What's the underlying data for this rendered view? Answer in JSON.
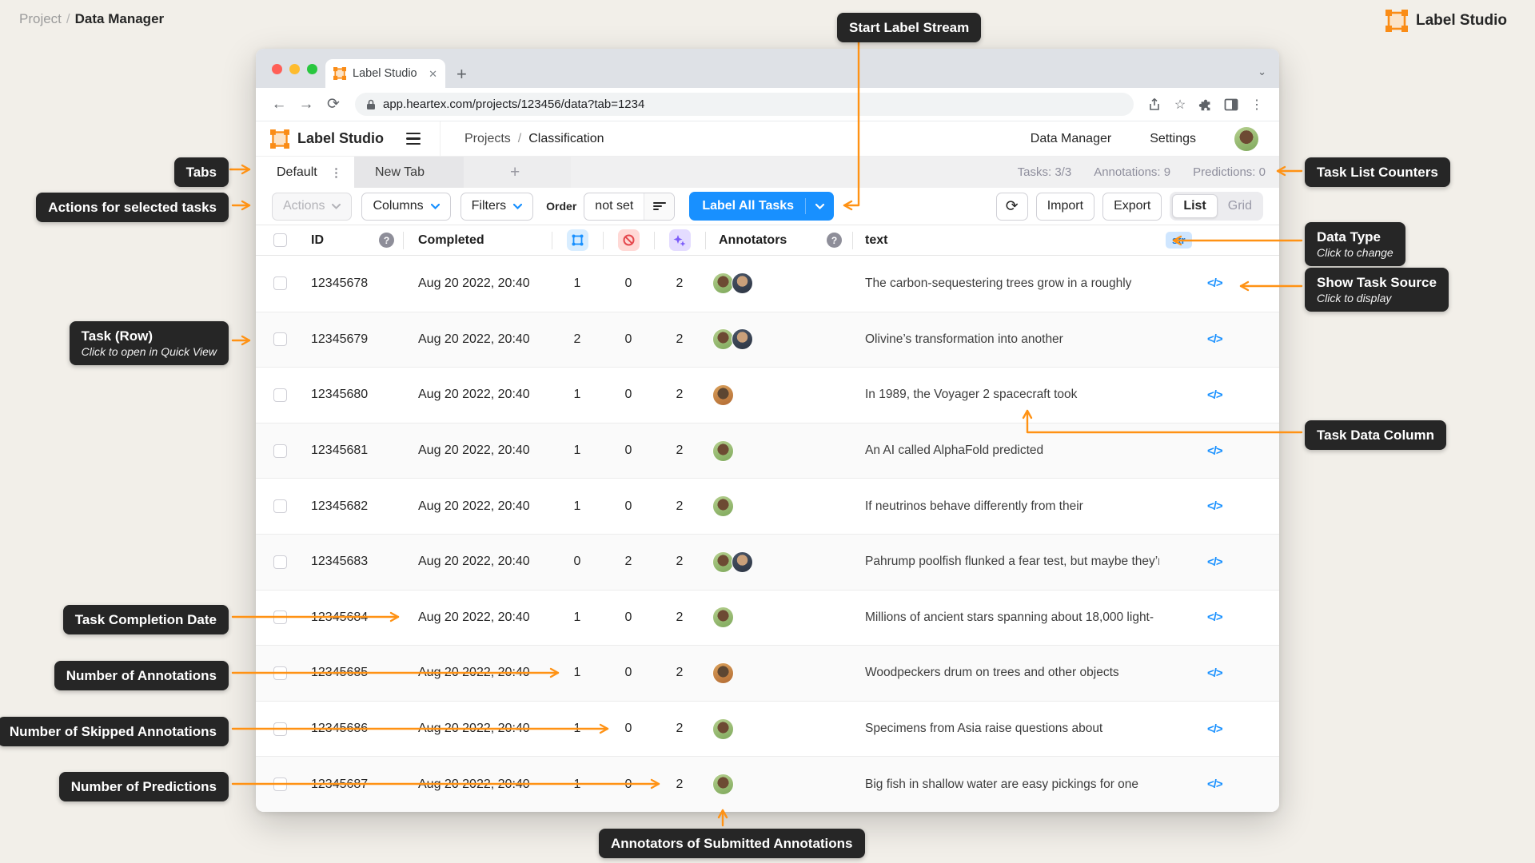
{
  "page": {
    "breadcrumb": {
      "parent": "Project",
      "divider": "/",
      "current": "Data Manager"
    },
    "brand": "Label Studio"
  },
  "browser": {
    "tab_title": "Label Studio",
    "url": "app.heartex.com/projects/123456/data?tab=1234"
  },
  "header": {
    "brand": "Label Studio",
    "breadcrumb_root": "Projects",
    "breadcrumb_divider": "/",
    "breadcrumb_current": "Classification",
    "nav_data_manager": "Data Manager",
    "nav_settings": "Settings"
  },
  "view_tabs": {
    "active_tab": "Default",
    "second_tab": "New Tab",
    "counters": [
      {
        "label": "Tasks:",
        "value": "3/3"
      },
      {
        "label": "Annotations:",
        "value": "9"
      },
      {
        "label": "Predictions:",
        "value": "0"
      }
    ]
  },
  "toolbar": {
    "actions": "Actions",
    "columns": "Columns",
    "filters": "Filters",
    "order_label": "Order",
    "order_value": "not set",
    "label_all_tasks": "Label All Tasks",
    "import": "Import",
    "export": "Export",
    "list": "List",
    "grid": "Grid"
  },
  "table": {
    "header": {
      "id": "ID",
      "completed": "Completed",
      "annotators": "Annotators",
      "text": "text",
      "data_type": "str"
    },
    "source_icon": "</>",
    "rows": [
      {
        "id": "12345678",
        "completed": "Aug 20 2022, 20:40",
        "annotations": "1",
        "skipped": "0",
        "predictions": "2",
        "annotators": [
          "a",
          "b"
        ],
        "text": "The carbon-sequestering trees grow in a roughly"
      },
      {
        "id": "12345679",
        "completed": "Aug 20 2022, 20:40",
        "annotations": "2",
        "skipped": "0",
        "predictions": "2",
        "annotators": [
          "a",
          "b"
        ],
        "text": "Olivine’s transformation into another"
      },
      {
        "id": "12345680",
        "completed": "Aug 20 2022, 20:40",
        "annotations": "1",
        "skipped": "0",
        "predictions": "2",
        "annotators": [
          "c"
        ],
        "text": "In 1989, the Voyager 2 spacecraft took"
      },
      {
        "id": "12345681",
        "completed": "Aug 20 2022, 20:40",
        "annotations": "1",
        "skipped": "0",
        "predictions": "2",
        "annotators": [
          "a"
        ],
        "text": "An AI called AlphaFold predicted"
      },
      {
        "id": "12345682",
        "completed": "Aug 20 2022, 20:40",
        "annotations": "1",
        "skipped": "0",
        "predictions": "2",
        "annotators": [
          "a"
        ],
        "text": "If neutrinos behave differently from their"
      },
      {
        "id": "12345683",
        "completed": "Aug 20 2022, 20:40",
        "annotations": "0",
        "skipped": "2",
        "predictions": "2",
        "annotators": [
          "a",
          "b"
        ],
        "text": "Pahrump poolfish flunked a fear test, but maybe they’re"
      },
      {
        "id": "12345684",
        "completed": "Aug 20 2022, 20:40",
        "annotations": "1",
        "skipped": "0",
        "predictions": "2",
        "annotators": [
          "a"
        ],
        "text": "Millions of ancient stars spanning about 18,000 light-"
      },
      {
        "id": "12345685",
        "completed": "Aug 20 2022, 20:40",
        "annotations": "1",
        "skipped": "0",
        "predictions": "2",
        "annotators": [
          "c"
        ],
        "text": "Woodpeckers drum on trees and other objects"
      },
      {
        "id": "12345686",
        "completed": "Aug 20 2022, 20:40",
        "annotations": "1",
        "skipped": "0",
        "predictions": "2",
        "annotators": [
          "a"
        ],
        "text": "Specimens from Asia raise questions about"
      },
      {
        "id": "12345687",
        "completed": "Aug 20 2022, 20:40",
        "annotations": "1",
        "skipped": "0",
        "predictions": "2",
        "annotators": [
          "a"
        ],
        "text": "Big fish in shallow water are easy pickings for one"
      }
    ]
  },
  "callouts": {
    "start_label_stream": {
      "title": "Start Label Stream"
    },
    "tabs": {
      "title": "Tabs"
    },
    "actions": {
      "title": "Actions for selected tasks"
    },
    "task_row": {
      "title": "Task (Row)",
      "subtitle": "Click to open in Quick View"
    },
    "task_completion_date": {
      "title": "Task Completion Date"
    },
    "number_annotations": {
      "title": "Number of Annotations"
    },
    "number_skipped": {
      "title": "Number of Skipped Annotations"
    },
    "number_predictions": {
      "title": "Number of Predictions"
    },
    "task_list_counters": {
      "title": "Task List Counters"
    },
    "data_type": {
      "title": "Data Type",
      "subtitle": "Click to change"
    },
    "show_task_source": {
      "title": "Show Task Source",
      "subtitle": "Click to display"
    },
    "task_data_column": {
      "title": "Task Data Column"
    },
    "annotators_submitted": {
      "title": "Annotators of Submitted Annotations"
    }
  },
  "colors": {
    "accent": "#FF9214",
    "primary": "#1890FF",
    "callout_bg": "#262626"
  }
}
